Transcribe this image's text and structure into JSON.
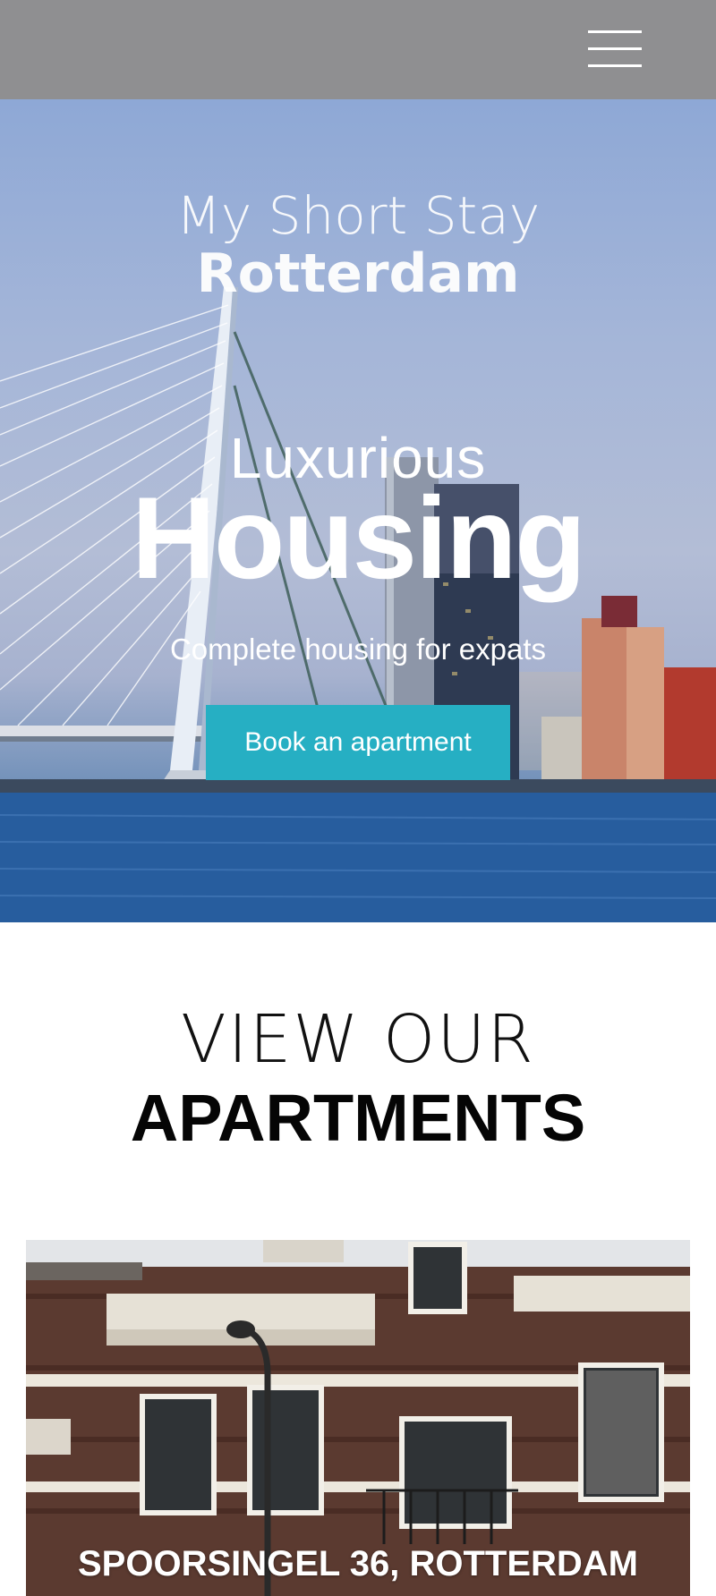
{
  "header": {
    "menu_icon": "hamburger-menu-icon",
    "background": "#8f8f91"
  },
  "hero": {
    "logo_line1": "My Short Stay",
    "logo_line2": "Rotterdam",
    "subtitle": "Luxurious",
    "title": "Housing",
    "tagline": "Complete housing for expats",
    "cta_label": "Book an apartment",
    "cta_color": "#26afc3"
  },
  "apartments_section": {
    "heading_top": "VIEW OUR",
    "heading_bottom": "APARTMENTS",
    "cards": [
      {
        "caption": "SPOORSINGEL 36, ROTTERDAM"
      }
    ]
  }
}
